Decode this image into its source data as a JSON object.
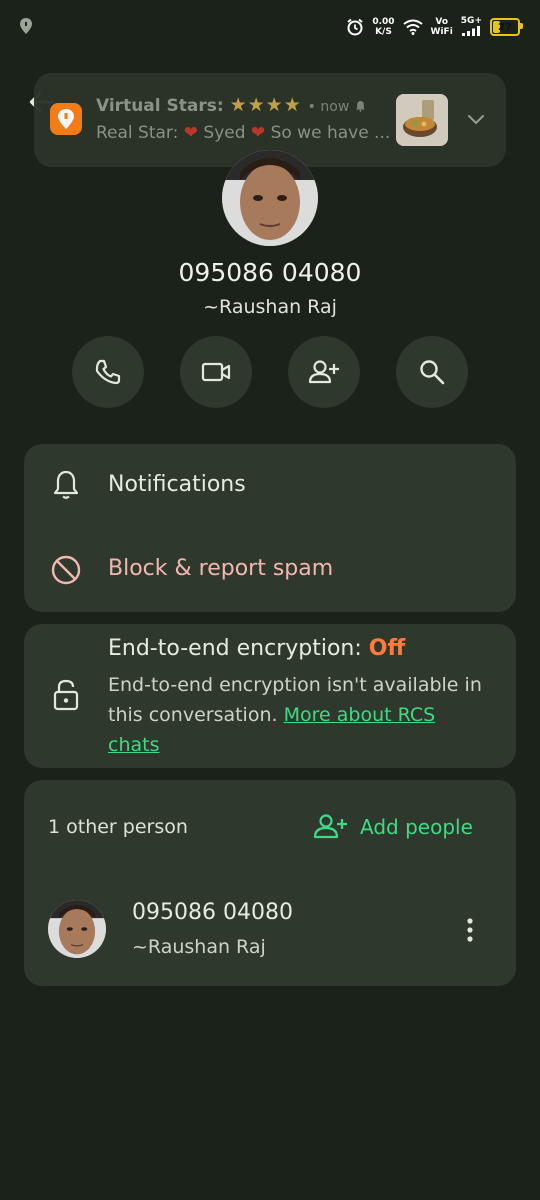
{
  "status_bar": {
    "speed_value": "0.00",
    "speed_unit": "K/S",
    "vo_top": "Vo",
    "vo_bottom": "WiFi",
    "network": "5G+",
    "battery": "27",
    "battery_level_percent": 27,
    "icons": [
      "swiggy-notification-icon",
      "alarm-icon",
      "wifi-icon",
      "signal-icon",
      "battery-icon"
    ]
  },
  "notification": {
    "app_icon": "swiggy-icon",
    "title": "Virtual Stars:",
    "stars": "★★★★",
    "time": "now",
    "body_prefix": "Real Star: ",
    "body_name": " Syed ",
    "body_suffix": " So we have ...",
    "heart_color": "#c0392b"
  },
  "contact": {
    "phone": "095086 04080",
    "name": "~Raushan Raj"
  },
  "actions": [
    {
      "icon": "phone-icon"
    },
    {
      "icon": "video-call-icon"
    },
    {
      "icon": "add-contact-icon"
    },
    {
      "icon": "search-icon"
    }
  ],
  "settings": {
    "notifications_label": "Notifications",
    "block_label": "Block & report spam",
    "block_color": "#f2b8b0"
  },
  "encryption": {
    "title_prefix": "End-to-end encryption: ",
    "status": "Off",
    "status_color": "#ff7a3d",
    "description": "End-to-end encryption isn't available in this conversation. ",
    "link_text": "More about RCS chats"
  },
  "people": {
    "count_label": "1 other person",
    "add_label": "Add people",
    "accent": "#3ddc84",
    "members": [
      {
        "phone": "095086 04080",
        "name": "~Raushan Raj"
      }
    ]
  }
}
